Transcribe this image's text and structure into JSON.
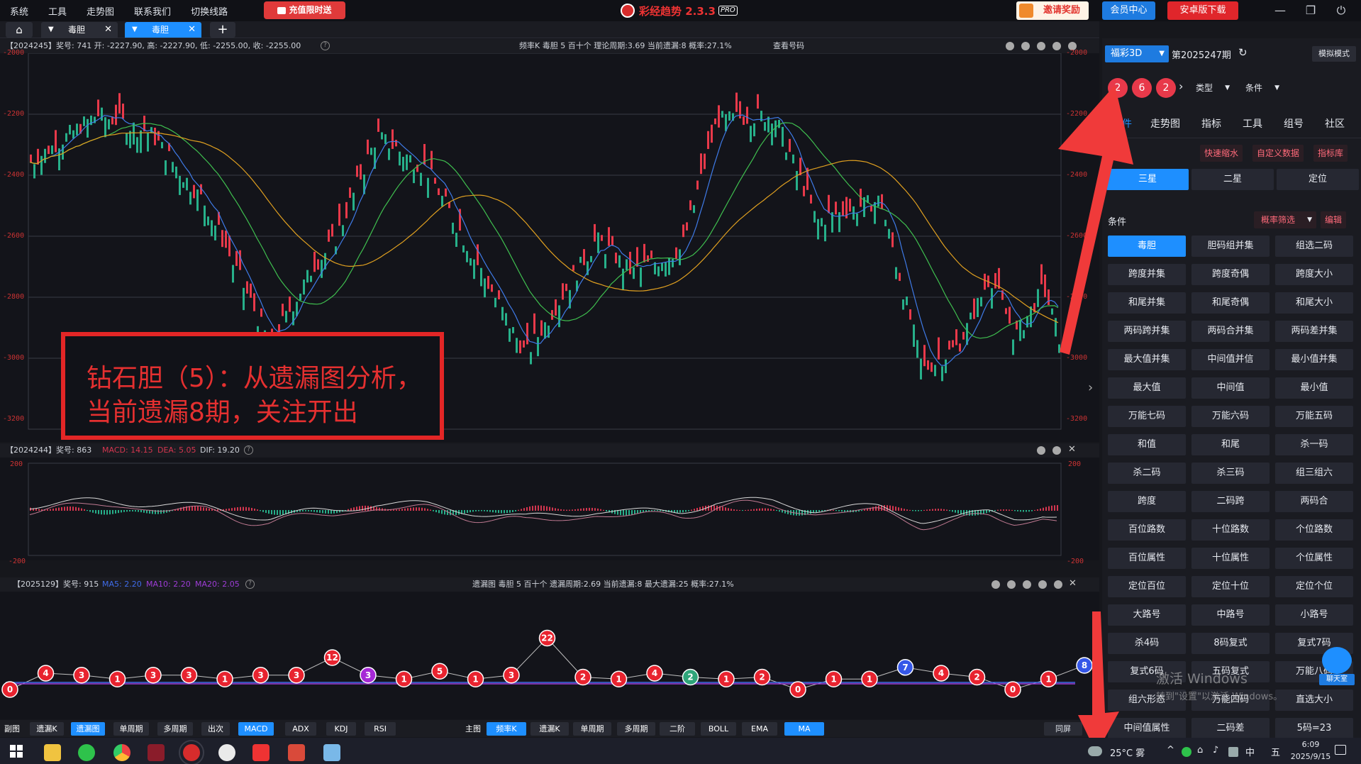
{
  "menu": {
    "items": [
      "系统",
      "工具",
      "走势图",
      "联系我们",
      "切换线路"
    ],
    "promo": "充值限时送"
  },
  "app": {
    "title": "彩经趋势 2.3.3",
    "badge": "PRO"
  },
  "header_buttons": {
    "invite": "邀请奖励",
    "member": "会员中心",
    "android": "安卓版下载"
  },
  "tabs": [
    {
      "label": "毒胆"
    },
    {
      "label": "毒胆"
    }
  ],
  "chart1": {
    "info": "【2024245】奖号: 741   开: -2227.90, 高: -2227.90, 低: -2255.00, 收: -2255.00",
    "status": "频率K   毒胆   5   百十个   理论周期:3.69   当前遗漏:8   概率:27.1%",
    "view_numbers": "查看号码",
    "yticks_left": [
      "-2000",
      "-2200",
      "-2400",
      "-2600",
      "-2800",
      "-3000",
      "-3200"
    ],
    "yticks_right": [
      "-2000",
      "-2200",
      "-2400",
      "-2600",
      "-2800",
      "-3000",
      "-3200"
    ]
  },
  "annotation": {
    "line1": "钻石胆（5）：从遗漏图分析，",
    "line2": "当前遗漏8期，关注开出"
  },
  "chart2": {
    "prefix": "【2024244】奖号: 863",
    "macd": "MACD: 14.15",
    "dea": "DEA: 5.05",
    "dif": "DIF: 19.20",
    "yticks": [
      "200",
      "-200"
    ]
  },
  "chart3": {
    "prefix": "【2025129】奖号: 915",
    "ma5": "MA5: 2.20",
    "ma10": "MA10: 2.20",
    "ma20": "MA20: 2.05",
    "status": "遗漏图   毒胆   5   百十个   遗漏周期:2.69   当前遗漏:8   最大遗漏:25   概率:27.1%",
    "misses": [
      0,
      4,
      3,
      1,
      3,
      3,
      1,
      3,
      3,
      12,
      3,
      1,
      5,
      1,
      3,
      22,
      2,
      1,
      4,
      2,
      1,
      2,
      0,
      1,
      1,
      7,
      4,
      2,
      0,
      1,
      8
    ]
  },
  "bottom_left": {
    "items": [
      "副图",
      "遗漏K",
      "遗漏图",
      "单周期",
      "多周期",
      "出次",
      "MACD",
      "ADX",
      "KDJ",
      "RSI"
    ]
  },
  "bottom_mid": {
    "items": [
      "主图",
      "频率K",
      "遗漏K",
      "单周期",
      "多周期",
      "二阶",
      "BOLL",
      "EMA",
      "MA"
    ]
  },
  "bottom_right": {
    "label": "同屏"
  },
  "right": {
    "lottery": "福彩3D",
    "period": "第2025247期",
    "mode": "模拟模式",
    "balls": [
      "2",
      "6",
      "2"
    ],
    "type_label": "类型",
    "cond_label": "条件",
    "tabs": [
      "条件",
      "走势图",
      "指标",
      "工具",
      "组号",
      "社区"
    ],
    "tools": [
      "快速缩水",
      "自定义数据",
      "指标库"
    ],
    "positions": [
      "三星",
      "二星",
      "定位"
    ],
    "section": "条件",
    "filter": "概率筛选",
    "edit": "编辑",
    "conditions": [
      "毒胆",
      "胆码组并集",
      "组选二码",
      "跨度并集",
      "跨度奇偶",
      "跨度大小",
      "和尾并集",
      "和尾奇偶",
      "和尾大小",
      "两码跨并集",
      "两码合并集",
      "两码差并集",
      "最大值并集",
      "中间值并信",
      "最小值并集",
      "最大值",
      "中间值",
      "最小值",
      "万能七码",
      "万能六码",
      "万能五码",
      "和值",
      "和尾",
      "杀一码",
      "杀二码",
      "杀三码",
      "组三组六",
      "跨度",
      "二码跨",
      "两码合",
      "百位路数",
      "十位路数",
      "个位路数",
      "百位属性",
      "十位属性",
      "个位属性",
      "定位百位",
      "定位十位",
      "定位个位",
      "大路号",
      "中路号",
      "小路号",
      "杀4码",
      "8码复式",
      "复式7码",
      "复式6码",
      "五码复式",
      "万能八码",
      "组六形态",
      "万能四码",
      "直选大小",
      "中间值属性",
      "二码差",
      "5码=23"
    ],
    "chat": "聊天室"
  },
  "watermark": {
    "line1": "激活 Windows",
    "line2": "转到\"设置\"以激活 Windows。"
  },
  "taskbar": {
    "weather": "25°C 雾",
    "ime": "中",
    "ime2": "五",
    "time": "6:09",
    "date": "2025/9/15"
  }
}
